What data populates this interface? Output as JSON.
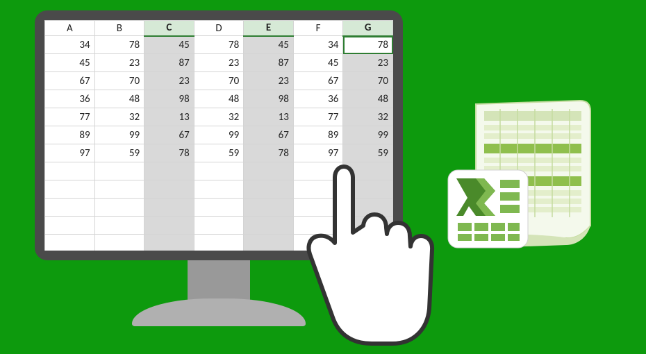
{
  "spreadsheet": {
    "columns": [
      "A",
      "B",
      "C",
      "D",
      "E",
      "F",
      "G"
    ],
    "selectedColumns": [
      "C",
      "E",
      "G"
    ],
    "activeCell": {
      "col": "G",
      "row": 0
    },
    "rows": [
      [
        34,
        78,
        45,
        78,
        45,
        34,
        78
      ],
      [
        45,
        23,
        87,
        23,
        87,
        45,
        23
      ],
      [
        67,
        70,
        23,
        70,
        23,
        67,
        70
      ],
      [
        36,
        48,
        98,
        48,
        98,
        36,
        48
      ],
      [
        77,
        32,
        13,
        32,
        13,
        77,
        32
      ],
      [
        89,
        99,
        67,
        99,
        67,
        89,
        99
      ],
      [
        97,
        59,
        78,
        59,
        78,
        97,
        59
      ]
    ],
    "blankRows": 5
  }
}
